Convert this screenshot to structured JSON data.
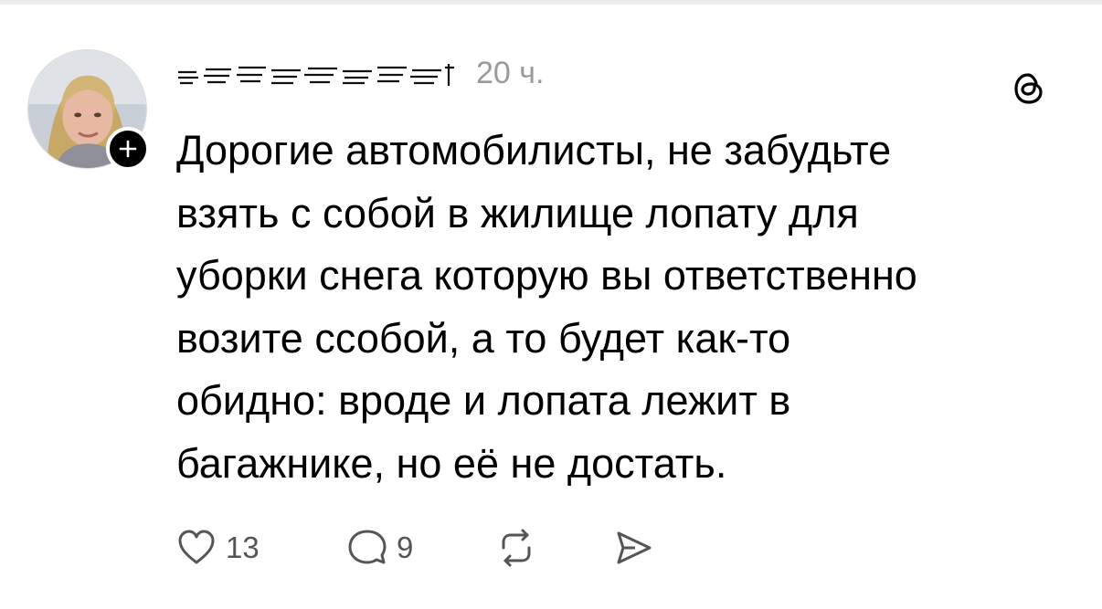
{
  "post": {
    "username": "svetlanaasta1",
    "timestamp": "20 ч.",
    "text_lines": [
      "Дорогие автомобилисты, не забудьте",
      "взять с собой в жилище лопату для",
      "уборки снега которую вы ответственно",
      "возите ссобой, а то будет как-то",
      "обидно: вроде и лопата лежит в",
      "багажнике, но её не достать."
    ],
    "likes": "13",
    "comments": "9"
  },
  "icons": {
    "follow": "plus-icon",
    "brand": "threads-logo-icon",
    "like": "heart-icon",
    "comment": "speech-bubble-icon",
    "repost": "repost-arrows-icon",
    "share": "send-icon"
  },
  "colors": {
    "text": "#000000",
    "muted": "#9a9a9a",
    "icon": "#555555",
    "badge": "#000000"
  }
}
